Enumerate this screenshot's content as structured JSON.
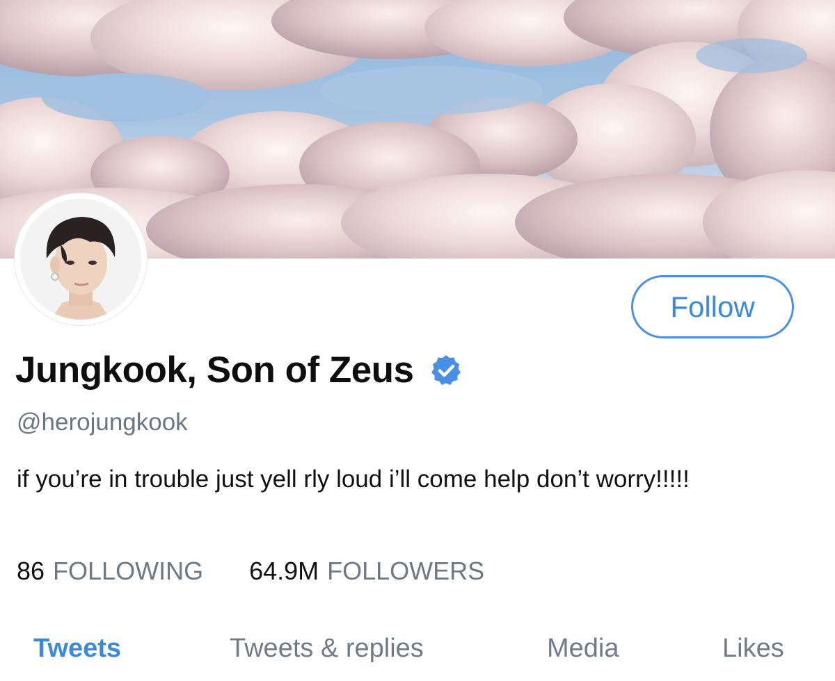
{
  "profile": {
    "display_name": "Jungkook, Son of Zeus",
    "handle": "@herojungkook",
    "bio": "if you’re in trouble just yell rly loud i’ll come help don’t worry!!!!!",
    "verified_icon": "verified-badge-icon",
    "avatar": "profile-photo"
  },
  "actions": {
    "follow_label": "Follow"
  },
  "stats": {
    "following_count": "86",
    "following_label": "FOLLOWING",
    "followers_count": "64.9M",
    "followers_label": "FOLLOWERS"
  },
  "tabs": [
    {
      "label": "Tweets",
      "active": true
    },
    {
      "label": "Tweets & replies",
      "active": false
    },
    {
      "label": "Media",
      "active": false
    },
    {
      "label": "Likes",
      "active": false
    }
  ],
  "colors": {
    "accent": "#3b8ad8",
    "text": "#111111",
    "muted": "#6b7885",
    "verified": "#4a90e2"
  }
}
